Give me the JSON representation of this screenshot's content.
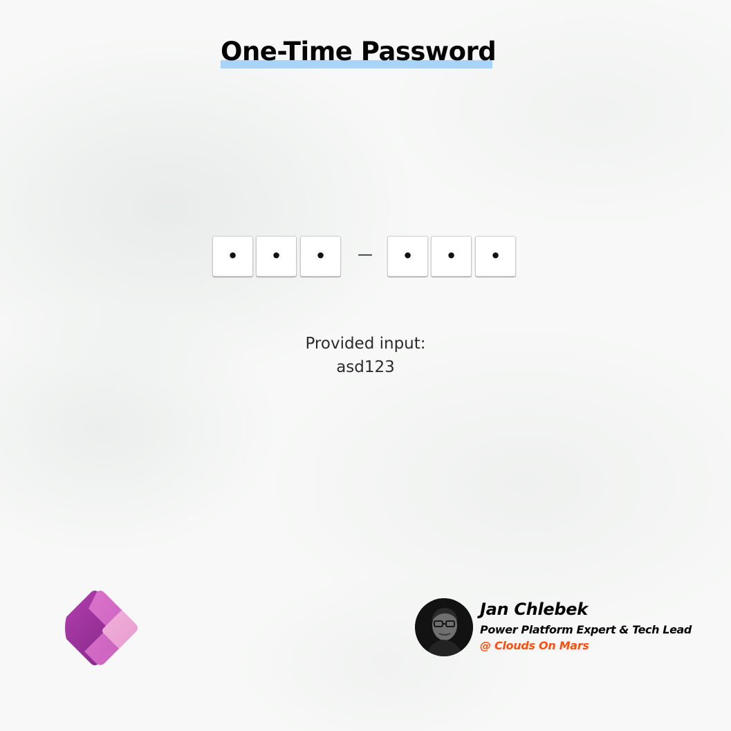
{
  "title": "One-Time Password",
  "otp": {
    "groups": [
      [
        "•",
        "•",
        "•"
      ],
      [
        "•",
        "•",
        "•"
      ]
    ],
    "separator": "—"
  },
  "provided": {
    "label": "Provided input:",
    "value": "asd123"
  },
  "branding": {
    "logo_icon": "power-apps-logo-icon"
  },
  "author": {
    "name": "Jan Chlebek",
    "role": "Power Platform Expert & Tech Lead",
    "company": "@ Clouds On Mars",
    "avatar_icon": "author-avatar"
  },
  "colors": {
    "title_underline": "#a9d4fa",
    "company_accent": "#ff4d0d",
    "background": "#f7f8f7",
    "logo_dark": "#8e2f93",
    "logo_mid": "#c45fc0",
    "logo_light": "#eba8d2"
  }
}
